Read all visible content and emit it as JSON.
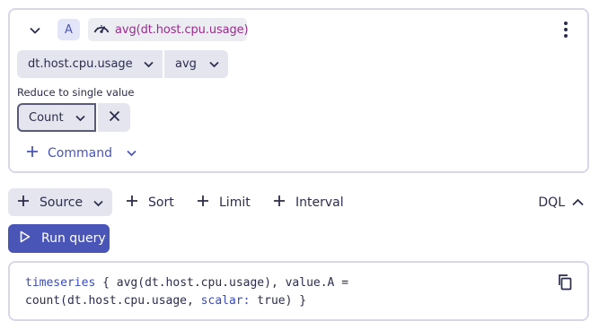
{
  "query_card": {
    "letter": "A",
    "expression": "avg(dt.host.cpu.usage)",
    "metric_select": "dt.host.cpu.usage",
    "aggregation_select": "avg",
    "reduce_label": "Reduce to single value",
    "reduce_value": "Count",
    "command_label": "Command"
  },
  "toolbar": {
    "source_label": "Source",
    "sort_label": "Sort",
    "limit_label": "Limit",
    "interval_label": "Interval",
    "dql_label": "DQL"
  },
  "run_query_label": "Run query",
  "dql": {
    "line1_kw": "timeseries",
    "line1_rest": " { avg(dt.host.cpu.usage), value.A =",
    "line2_start": "count(dt.host.cpu.usage, ",
    "line2_kw": "scalar:",
    "line2_end": " true) }"
  },
  "colors": {
    "accent": "#4a55b8",
    "expression_text": "#9b2c8e",
    "chip_bg": "#e4e5ee",
    "border": "#d6d8ea"
  },
  "icons": [
    "chevron-down-icon",
    "gauge-icon",
    "kebab-menu-icon",
    "close-icon",
    "plus-icon",
    "chevron-up-icon",
    "play-icon",
    "copy-icon"
  ]
}
